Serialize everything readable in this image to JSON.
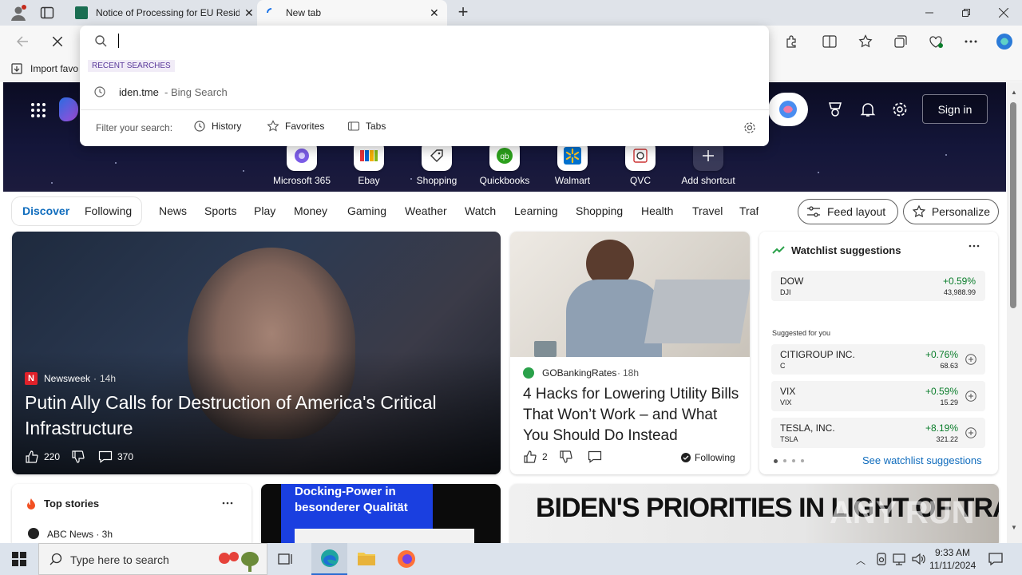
{
  "tabs": [
    {
      "title": "Notice of Processing for EU Resid"
    },
    {
      "title": "New tab"
    }
  ],
  "favorites_bar": {
    "import_label": "Import favo"
  },
  "omnibox": {
    "recent_header": "RECENT SEARCHES",
    "recent_query": "iden.tme",
    "recent_suffix": " - Bing Search",
    "filter_label": "Filter your search:",
    "filters": [
      "History",
      "Favorites",
      "Tabs"
    ]
  },
  "header": {
    "sign_in": "Sign in"
  },
  "shortcuts": [
    "Microsoft 365",
    "Ebay",
    "Shopping",
    "Quickbooks",
    "Walmart",
    "QVC",
    "Add shortcut"
  ],
  "nav": {
    "discover": "Discover",
    "following": "Following",
    "items": [
      "News",
      "Sports",
      "Play",
      "Money",
      "Gaming",
      "Weather",
      "Watch",
      "Learning",
      "Shopping",
      "Health",
      "Travel",
      "Traf"
    ],
    "feed_layout": "Feed layout",
    "personalize": "Personalize"
  },
  "main_story": {
    "source": "Newsweek",
    "age": "14h",
    "headline": "Putin Ally Calls for Destruction of America's Critical Infrastructure",
    "likes": "220",
    "comments": "370"
  },
  "second_story": {
    "source": "GOBankingRates",
    "age": "18h",
    "headline": "4 Hacks for Lowering Utility Bills That Won’t Work – and What You Should Do Instead",
    "likes": "2",
    "following": "Following"
  },
  "watchlist": {
    "title": "Watchlist suggestions",
    "primary": {
      "name": "DOW",
      "symbol": "DJI",
      "change": "+0.59%",
      "price": "43,988.99"
    },
    "suggested_label": "Suggested for you",
    "items": [
      {
        "name": "CITIGROUP INC.",
        "symbol": "C",
        "change": "+0.76%",
        "price": "68.63"
      },
      {
        "name": "VIX",
        "symbol": "VIX",
        "change": "+0.59%",
        "price": "15.29"
      },
      {
        "name": "TESLA, INC.",
        "symbol": "TSLA",
        "change": "+8.19%",
        "price": "321.22"
      }
    ],
    "see_more": "See watchlist suggestions"
  },
  "top_stories": {
    "title": "Top stories",
    "first_source": "ABC News · 3h"
  },
  "ad": {
    "text": "Docking-Power in besonderer Qualität"
  },
  "bottom_story": {
    "headline": "BIDEN'S PRIORITIES IN LIGHT OF TRANSITION OF POWER"
  },
  "watermark": "ANY RUN",
  "taskbar": {
    "search_placeholder": "Type here to search",
    "time": "9:33 AM",
    "date": "11/11/2024"
  }
}
